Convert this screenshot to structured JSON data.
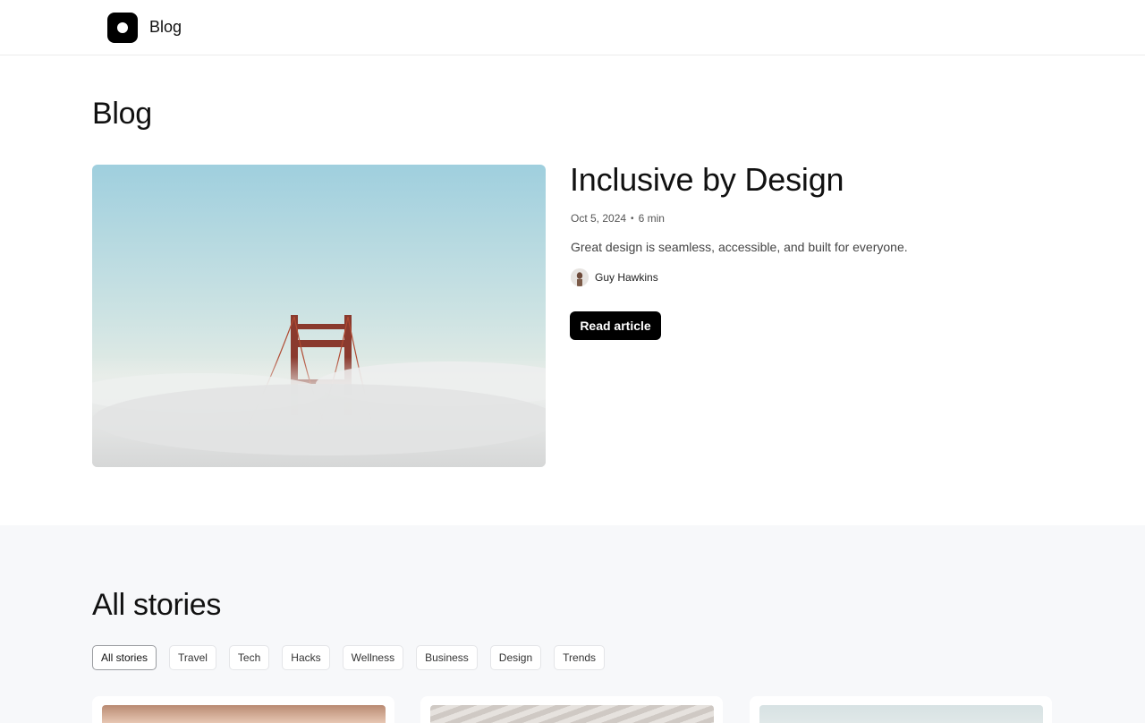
{
  "header": {
    "brand": "Blog",
    "logo_icon": "logo-dot-icon"
  },
  "page": {
    "title": "Blog"
  },
  "featured": {
    "image": "golden-gate-bridge-in-fog",
    "title": "Inclusive by Design",
    "date": "Oct 5, 2024",
    "separator": "•",
    "read_time": "6 min",
    "excerpt": "Great design is seamless, accessible, and built for everyone.",
    "author": "Guy Hawkins",
    "button": "Read article"
  },
  "stories": {
    "title": "All stories",
    "filters": [
      "All stories",
      "Travel",
      "Tech",
      "Hacks",
      "Wellness",
      "Business",
      "Design",
      "Trends"
    ],
    "active_filter": "All stories"
  },
  "colors": {
    "accent": "#000000",
    "section_bg": "#f7f8fa"
  }
}
